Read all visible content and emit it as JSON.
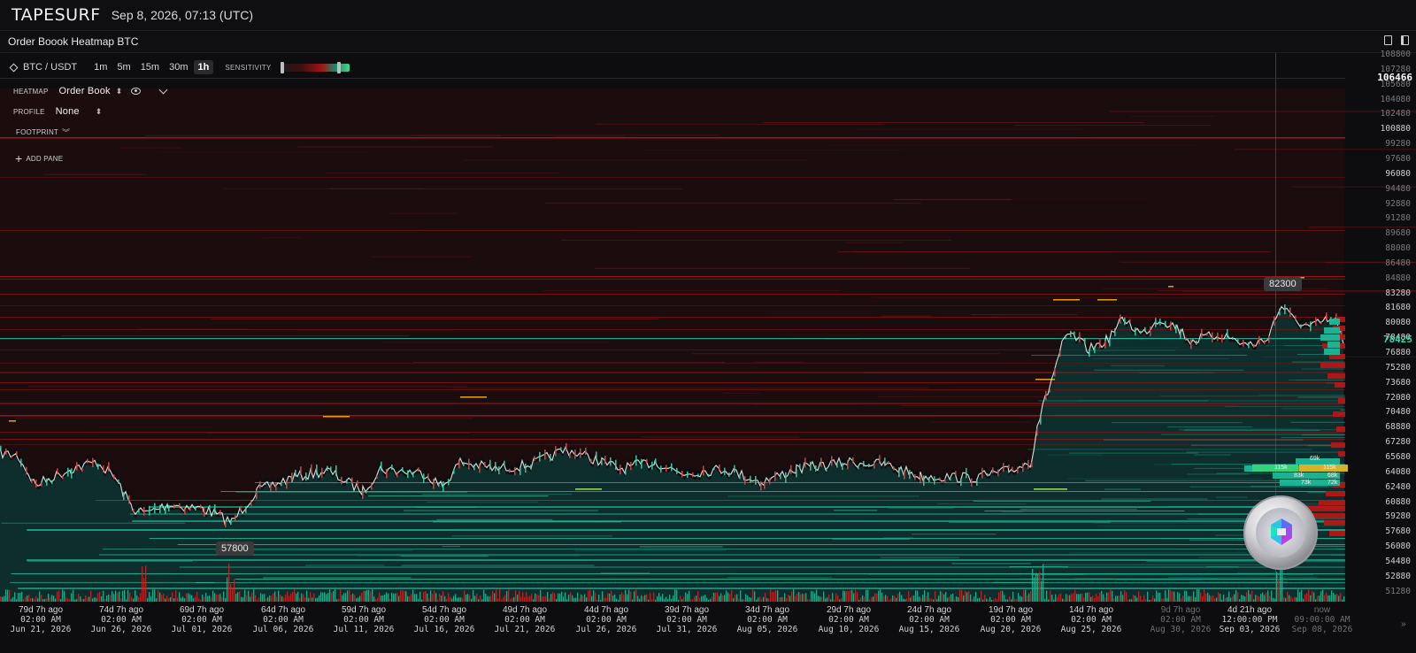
{
  "app": {
    "logo": "TAPESURF",
    "datetime": "Sep 8, 2026, 07:13 (UTC)"
  },
  "window": {
    "title": "Order Boook Heatmap BTC"
  },
  "toolbar": {
    "pair": "BTC / USDT",
    "timeframes": [
      "1m",
      "5m",
      "15m",
      "30m",
      "1h"
    ],
    "active_timeframe": "1h",
    "sensitivity_label": "SENSITIVITY"
  },
  "panel": {
    "heatmap_label": "HEATMAP",
    "heatmap_value": "Order Book",
    "profile_label": "PROFILE",
    "profile_value": "None",
    "footprint_label": "FOOTPRINT",
    "add_pane_label": "ADD PANE"
  },
  "price_axis": {
    "labels": [
      "108800",
      "107280",
      "105680",
      "104080",
      "102480",
      "100880",
      "99280",
      "97680",
      "96080",
      "94480",
      "92880",
      "91280",
      "89680",
      "88080",
      "86480",
      "84880",
      "83280",
      "81680",
      "80080",
      "78480",
      "76880",
      "75280",
      "73680",
      "72080",
      "70480",
      "68880",
      "67280",
      "65680",
      "64080",
      "62480",
      "60880",
      "59280",
      "57680",
      "56080",
      "54480",
      "52880",
      "51280"
    ],
    "current_price": "106466",
    "last_price": "78425"
  },
  "badges": {
    "high": "82300",
    "low": "57800"
  },
  "time_axis": [
    {
      "ago": "79d 7h ago",
      "time": "02:00 AM",
      "date": "Jun 21, 2026"
    },
    {
      "ago": "74d 7h ago",
      "time": "02:00 AM",
      "date": "Jun 26, 2026"
    },
    {
      "ago": "69d 7h ago",
      "time": "02:00 AM",
      "date": "Jul 01, 2026"
    },
    {
      "ago": "64d 7h ago",
      "time": "02:00 AM",
      "date": "Jul 06, 2026"
    },
    {
      "ago": "59d 7h ago",
      "time": "02:00 AM",
      "date": "Jul 11, 2026"
    },
    {
      "ago": "54d 7h ago",
      "time": "02:00 AM",
      "date": "Jul 16, 2026"
    },
    {
      "ago": "49d 7h ago",
      "time": "02:00 AM",
      "date": "Jul 21, 2026"
    },
    {
      "ago": "44d 7h ago",
      "time": "02:00 AM",
      "date": "Jul 26, 2026"
    },
    {
      "ago": "39d 7h ago",
      "time": "02:00 AM",
      "date": "Jul 31, 2026"
    },
    {
      "ago": "34d 7h ago",
      "time": "02:00 AM",
      "date": "Aug 05, 2026"
    },
    {
      "ago": "29d 7h ago",
      "time": "02:00 AM",
      "date": "Aug 10, 2026"
    },
    {
      "ago": "24d 7h ago",
      "time": "02:00 AM",
      "date": "Aug 15, 2026"
    },
    {
      "ago": "19d 7h ago",
      "time": "02:00 AM",
      "date": "Aug 20, 2026"
    },
    {
      "ago": "14d 7h ago",
      "time": "02:00 AM",
      "date": "Aug 25, 2026"
    },
    {
      "ago": "9d 7h ago",
      "time": "02:00 AM",
      "date": "Aug 30, 2026"
    },
    {
      "ago": "4d 21h ago",
      "time": "12:00:00 PM",
      "date": "Sep 03, 2026"
    },
    {
      "ago": "now",
      "time": "09:00:00 AM",
      "date": "Sep 08, 2026"
    }
  ],
  "orderbook_labels": [
    "69k",
    "115k",
    "115k",
    "83k",
    "68k",
    "73k",
    "72k"
  ],
  "colors": {
    "bid": "#1fb89a",
    "ask": "#b01818",
    "background": "#0d0d10",
    "highlight": "#ffb020"
  }
}
